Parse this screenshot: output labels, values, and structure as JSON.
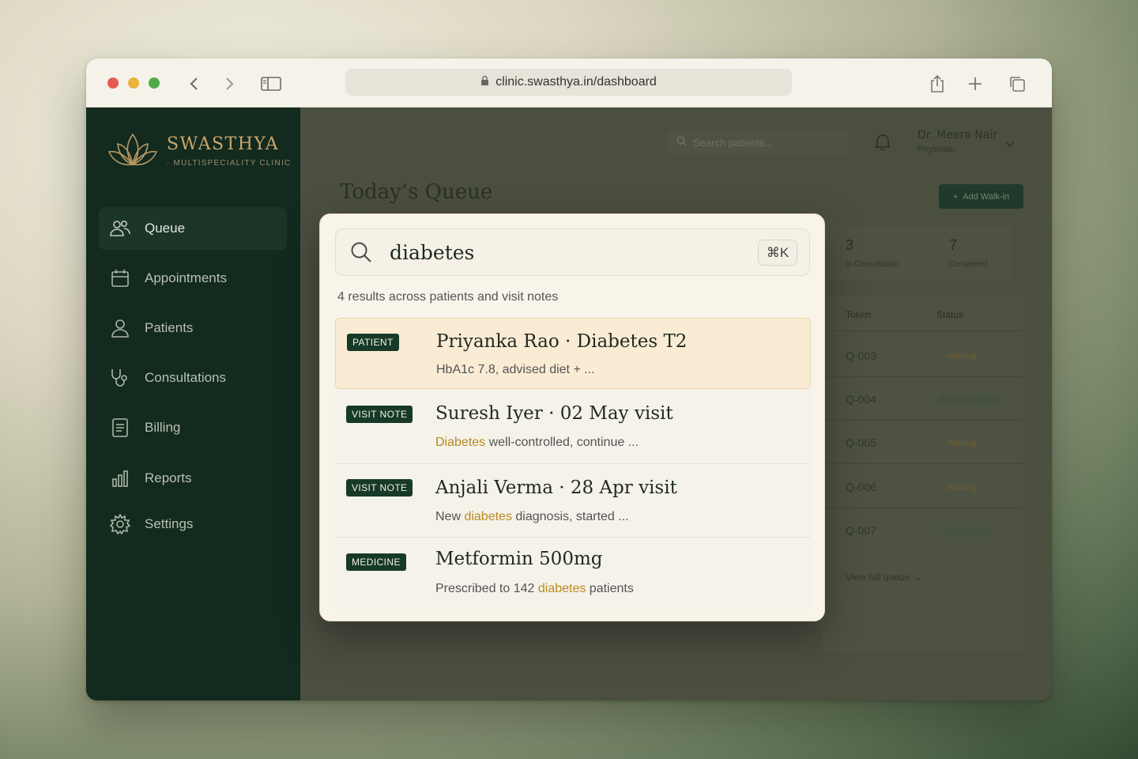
{
  "browser": {
    "url": "clinic.swasthya.in/dashboard"
  },
  "sidebar": {
    "brand_name": "SWASTHYA",
    "brand_tagline": "· MULTISPECIALITY CLINIC",
    "items": [
      {
        "label": "Queue",
        "icon": "users-icon",
        "active": true
      },
      {
        "label": "Appointments",
        "icon": "calendar-icon",
        "active": false
      },
      {
        "label": "Patients",
        "icon": "user-icon",
        "active": false
      },
      {
        "label": "Consultations",
        "icon": "stethoscope-icon",
        "active": false
      },
      {
        "label": "Billing",
        "icon": "document-icon",
        "active": false
      },
      {
        "label": "Reports",
        "icon": "bar-chart-icon",
        "active": false
      },
      {
        "label": "Settings",
        "icon": "gear-icon",
        "active": false
      }
    ]
  },
  "header": {
    "search_placeholder": "Search patients...",
    "user_name": "Dr. Meera Nair",
    "user_role": "Physician"
  },
  "main": {
    "page_title": "Today’s Queue",
    "add_walkin_label": "Add Walk-in",
    "stats": [
      {
        "value": "3",
        "label": "In Consultation"
      },
      {
        "value": "7",
        "label": "Completed"
      }
    ],
    "table": {
      "headers": [
        "Token",
        "Status"
      ],
      "rows": [
        {
          "token": "Q-003",
          "status": "Waiting"
        },
        {
          "token": "Q-004",
          "status": "In Consultation"
        },
        {
          "token": "Q-005",
          "status": "Waiting"
        },
        {
          "token": "Q-006",
          "status": "Waiting"
        },
        {
          "token": "Q-007",
          "status": "Completed"
        }
      ],
      "view_full_label": "View full queue"
    }
  },
  "search_modal": {
    "query": "diabetes",
    "shortcut": "⌘K",
    "results_summary": "4 results across patients and visit notes",
    "results": [
      {
        "tag": "PATIENT",
        "title": "Priyanka Rao · Diabetes T2",
        "sub_before": "HbA1c 7.8, advised diet + ...",
        "sub_highlight": "",
        "sub_after": "",
        "selected": true
      },
      {
        "tag": "VISIT NOTE",
        "title": "Suresh Iyer · 02 May visit",
        "sub_before": "",
        "sub_highlight": "Diabetes",
        "sub_after": " well-controlled, continue ..."
      },
      {
        "tag": "VISIT NOTE",
        "title": "Anjali Verma · 28 Apr visit",
        "sub_before": "New ",
        "sub_highlight": "diabetes",
        "sub_after": " diagnosis, started ..."
      },
      {
        "tag": "MEDICINE",
        "title": "Metformin 500mg",
        "sub_before": "Prescribed to 142 ",
        "sub_highlight": "diabetes",
        "sub_after": " patients"
      }
    ]
  },
  "colors": {
    "sidebar_bg": "#132a1f",
    "accent_gold": "#c9a66b",
    "highlight": "#b88a1f",
    "tag_bg": "#163a27"
  }
}
